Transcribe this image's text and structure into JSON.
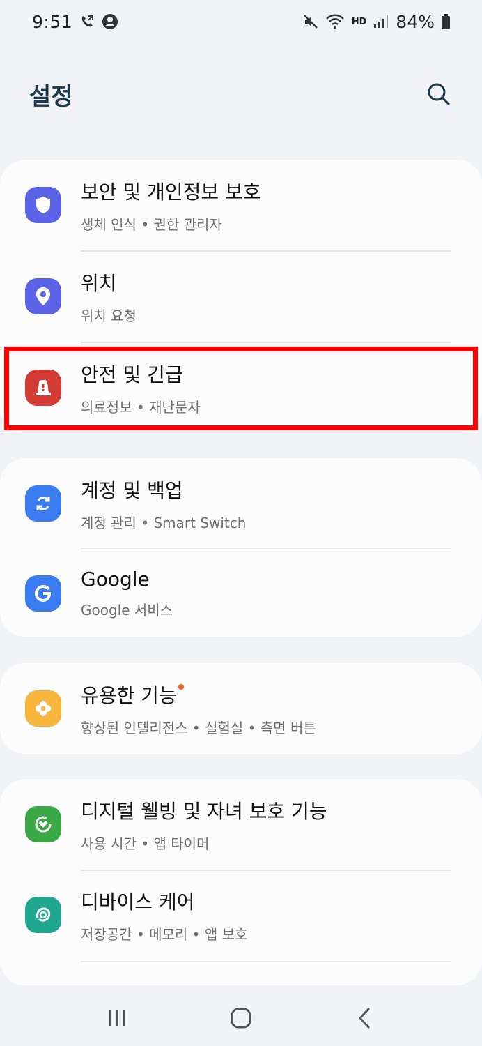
{
  "status_bar": {
    "time": "9:51",
    "battery": "84%",
    "network": "HD",
    "icons_left": [
      "call-forward-icon",
      "account-circle-icon"
    ],
    "icons_right": [
      "mute-icon",
      "wifi-icon",
      "hd-icon",
      "signal-icon",
      "battery-icon"
    ]
  },
  "header": {
    "title": "설정",
    "search_icon": "search-icon"
  },
  "cards": [
    {
      "items": [
        {
          "title": "보안 및 개인정보 보호",
          "subtitle": "생체 인식 • 권한 관리자",
          "icon": "shield-icon",
          "color": "#5b63e6"
        },
        {
          "title": "위치",
          "subtitle": "위치 요청",
          "icon": "location-pin-icon",
          "color": "#5b63e6"
        },
        {
          "title": "안전 및 긴급",
          "subtitle": "의료정보 • 재난문자",
          "icon": "emergency-light-icon",
          "color": "#d53b35"
        }
      ]
    },
    {
      "items": [
        {
          "title": "계정 및 백업",
          "subtitle": "계정 관리 • Smart Switch",
          "icon": "sync-icon",
          "color": "#3b7cf0"
        },
        {
          "title": "Google",
          "subtitle": "Google 서비스",
          "icon": "google-icon",
          "color": "#3b7cf0"
        }
      ]
    },
    {
      "items": [
        {
          "title": "유용한 기능",
          "subtitle": "향상된 인텔리전스 • 실험실 • 측면 버튼",
          "icon": "puzzle-icon",
          "color": "#f6b73c",
          "badge": true
        }
      ]
    },
    {
      "items": [
        {
          "title": "디지털 웰빙 및 자녀 보호 기능",
          "subtitle": "사용 시간 • 앱 타이머",
          "icon": "wellbeing-icon",
          "color": "#3aa845"
        },
        {
          "title": "디바이스 케어",
          "subtitle": "저장공간 • 메모리 • 앱 보호",
          "icon": "device-care-icon",
          "color": "#1fa88f"
        }
      ]
    }
  ],
  "nav": {
    "recent": "recent-apps-icon",
    "home": "home-icon",
    "back": "back-icon"
  },
  "colors": {
    "background": "#f1f3f6",
    "card": "#fcfcfd",
    "highlight": "#ff0000",
    "badge": "#e8622c"
  }
}
